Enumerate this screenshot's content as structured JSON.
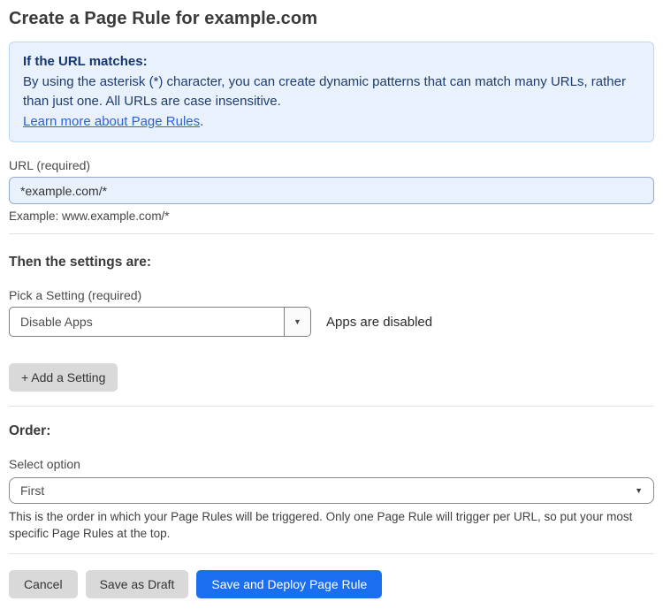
{
  "page": {
    "title": "Create a Page Rule for example.com"
  },
  "info_box": {
    "heading": "If the URL matches:",
    "body": "By using the asterisk (*) character, you can create dynamic patterns that can match many URLs, rather than just one. All URLs are case insensitive.",
    "link_label": "Learn more about Page Rules",
    "link_suffix": "."
  },
  "url_field": {
    "label": "URL (required)",
    "value": "*example.com/*",
    "helper": "Example: www.example.com/*"
  },
  "settings_section": {
    "heading": "Then the settings are:",
    "setting_label": "Pick a Setting (required)",
    "setting_value": "Disable Apps",
    "setting_status": "Apps are disabled",
    "add_setting_label": "+ Add a Setting"
  },
  "order_section": {
    "heading": "Order:",
    "select_label": "Select option",
    "select_value": "First",
    "helper": "This is the order in which your Page Rules will be triggered. Only one Page Rule will trigger per URL, so put your most specific Page Rules at the top."
  },
  "footer": {
    "cancel_label": "Cancel",
    "save_draft_label": "Save as Draft",
    "save_deploy_label": "Save and Deploy Page Rule"
  },
  "icons": {
    "dropdown_caret": "▼"
  },
  "colors": {
    "primary_button_blue": "#1a6ff0",
    "info_box_bg": "#e9f2fc",
    "info_box_border": "#bcd9f3",
    "info_text_navy": "#1e3c6e",
    "link_blue": "#2b62d9",
    "input_bg_blue": "#e9f1fd",
    "gray_button_bg": "#d9d9d9"
  }
}
